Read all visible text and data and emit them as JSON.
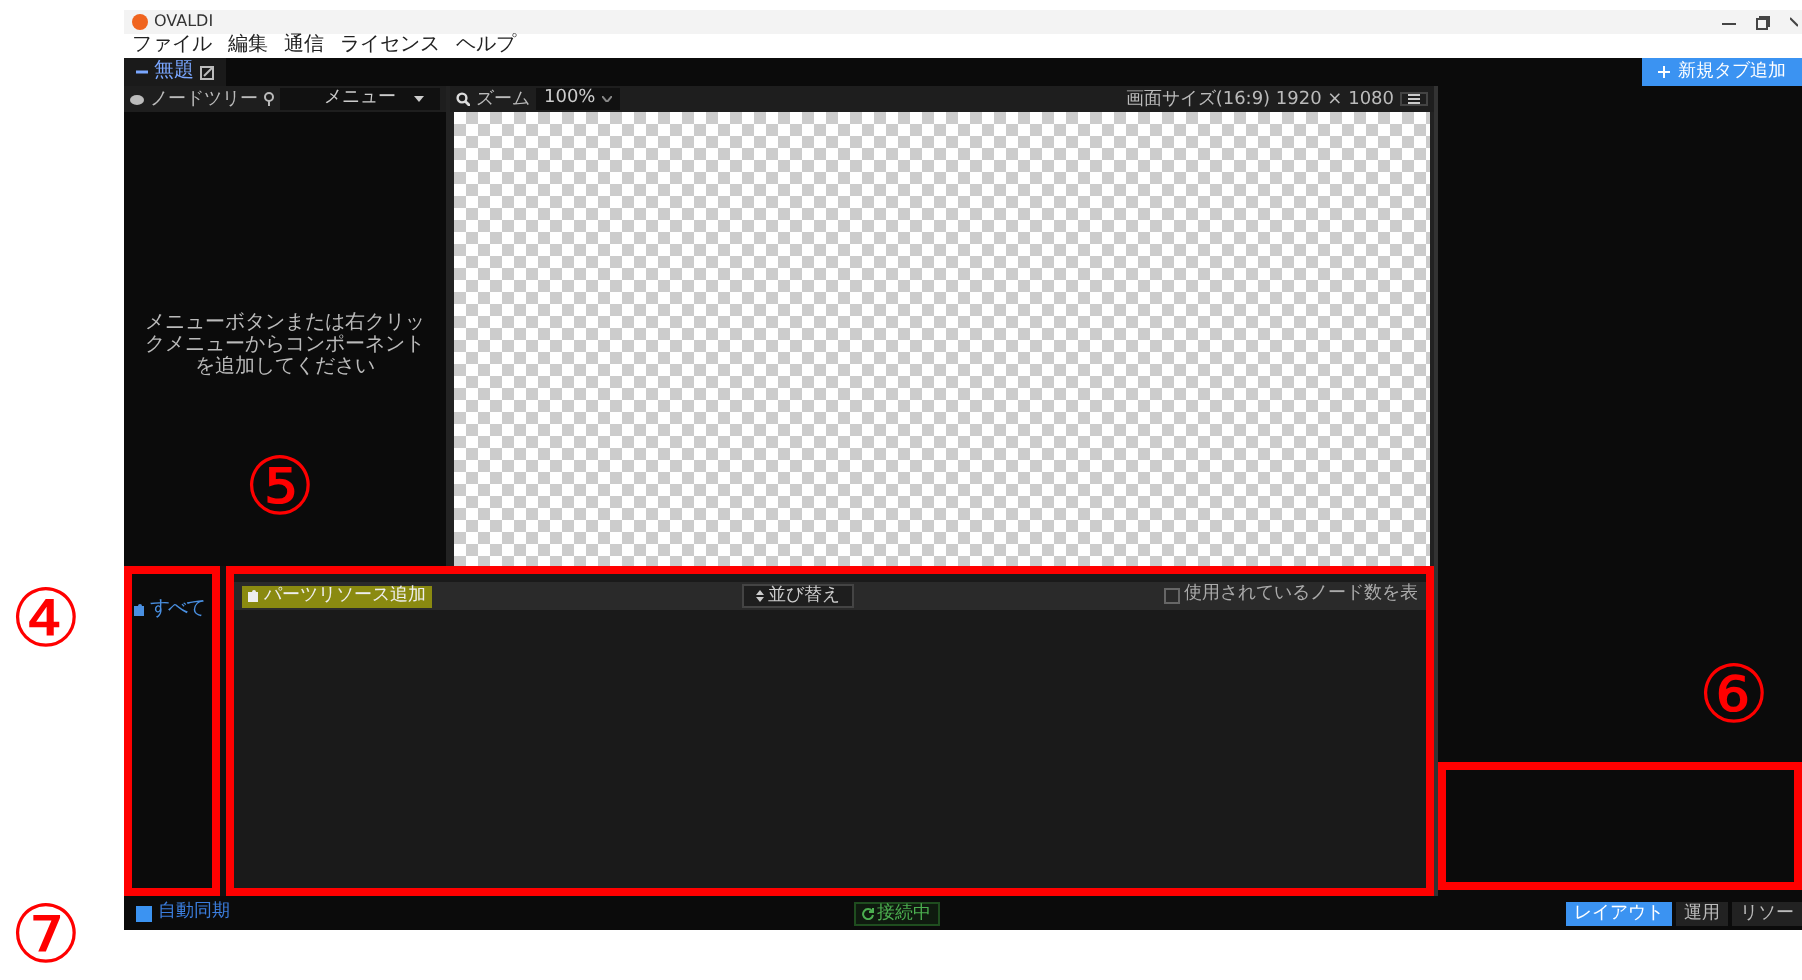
{
  "window": {
    "title": "OVALDI"
  },
  "menu": [
    "ファイル",
    "編集",
    "通信",
    "ライセンス",
    "ヘルプ"
  ],
  "tabs": [
    {
      "label": "無題",
      "selected": true
    }
  ],
  "new_tab_button": "新規タブ追加",
  "node_tree": {
    "label": "ノードツリー",
    "dropdown": "メニュー",
    "empty_message": "メニューボタンまたは右クリックメニューからコンポーネントを追加してください"
  },
  "canvas_toolbar": {
    "zoom_label": "ズーム",
    "zoom_value": "100%",
    "screen_size": "画面サイズ(16:9) 1920 × 1080"
  },
  "resource_sidebar": {
    "items": [
      {
        "label": "すべて",
        "selected": true
      }
    ],
    "annotation": {
      "number": "④",
      "boxed": true
    }
  },
  "parts_panel": {
    "add_button": "パーツリソース追加",
    "sort_button": "並び替え",
    "show_count": {
      "label": "使用されているノード数を表",
      "checked": false
    },
    "annotation": {
      "number": "⑤",
      "boxed": true
    }
  },
  "lower_right_panel": {
    "annotation": {
      "number": "⑥",
      "boxed": true
    }
  },
  "status_bar": {
    "auto_sync": {
      "label": "自動同期",
      "checked": true
    },
    "connection": "接続中",
    "mode_tabs": [
      {
        "label": "レイアウト",
        "selected": true
      },
      {
        "label": "運用",
        "selected": false
      },
      {
        "label": "リソー",
        "selected": false
      }
    ],
    "annotation": {
      "number": "⑦",
      "boxed": false
    }
  }
}
